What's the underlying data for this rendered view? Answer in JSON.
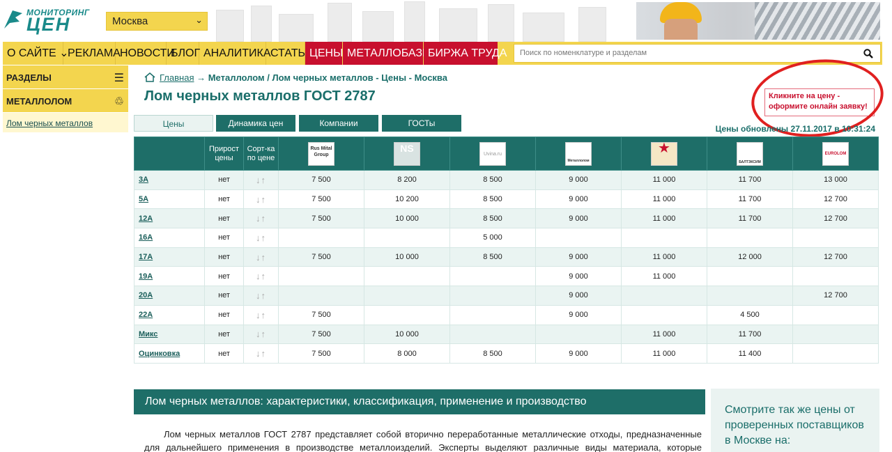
{
  "header": {
    "logo_top": "МОНИТОРИНГ",
    "logo_bottom": "ЦЕН",
    "city": "Москва"
  },
  "nav": {
    "items": [
      {
        "label": "О САЙТЕ",
        "red": false
      },
      {
        "label": "РЕКЛАМА",
        "red": false
      },
      {
        "label": "НОВОСТИ",
        "red": false
      },
      {
        "label": "БЛОГ",
        "red": false
      },
      {
        "label": "АНАЛИТИКА",
        "red": false
      },
      {
        "label": "СТАТЬИ",
        "red": false
      },
      {
        "label": "ЦЕНЫ",
        "red": true
      },
      {
        "label": "МЕТАЛЛОБАЗЫ",
        "red": true
      },
      {
        "label": "БИРЖА ТРУДА",
        "red": true
      }
    ],
    "search_placeholder": "Поиск по номенклатуре и разделам"
  },
  "sidebar": {
    "sections_label": "РАЗДЕЛЫ",
    "category_label": "МЕТАЛЛОЛОМ",
    "link": "Лом черных металлов"
  },
  "breadcrumb": {
    "home": "Главная",
    "rest": "Металлолом / Лом черных металлов - Цены - Москва"
  },
  "page_title": "Лом черных металлов ГОСТ 2787",
  "tabs": [
    "Цены",
    "Динамика цен",
    "Компании",
    "ГОСТы"
  ],
  "hint": "Кликните на цену - оформите онлайн заявку!",
  "updated": "Цены обновлены 27.11.2017 в 10:31:24",
  "table": {
    "headers": {
      "increase": "Прирост цены",
      "sort": "Сорт-ка по цене"
    },
    "companies": [
      "Rus Mital Group",
      "NS",
      "Uvina.ru",
      "Металлолом",
      "",
      "БАЛТЭКСИМ",
      "EUROLOM"
    ],
    "rows": [
      {
        "name": "3А",
        "inc": "нет",
        "v": [
          "7 500",
          "8 200",
          "8 500",
          "9 000",
          "11 000",
          "11 700",
          "13 000"
        ]
      },
      {
        "name": "5А",
        "inc": "нет",
        "v": [
          "7 500",
          "10 200",
          "8 500",
          "9 000",
          "11 000",
          "11 700",
          "12 700"
        ]
      },
      {
        "name": "12А",
        "inc": "нет",
        "v": [
          "7 500",
          "10 000",
          "8 500",
          "9 000",
          "11 000",
          "11 700",
          "12 700"
        ]
      },
      {
        "name": "16А",
        "inc": "нет",
        "v": [
          "",
          "",
          "5 000",
          "",
          "",
          "",
          ""
        ]
      },
      {
        "name": "17А",
        "inc": "нет",
        "v": [
          "7 500",
          "10 000",
          "8 500",
          "9 000",
          "11 000",
          "12 000",
          "12 700"
        ]
      },
      {
        "name": "19А",
        "inc": "нет",
        "v": [
          "",
          "",
          "",
          "9 000",
          "11 000",
          "",
          ""
        ]
      },
      {
        "name": "20А",
        "inc": "нет",
        "v": [
          "",
          "",
          "",
          "9 000",
          "",
          "",
          "12 700"
        ]
      },
      {
        "name": "22А",
        "inc": "нет",
        "v": [
          "7 500",
          "",
          "",
          "9 000",
          "",
          "4 500",
          ""
        ]
      },
      {
        "name": "Микс",
        "inc": "нет",
        "v": [
          "7 500",
          "10 000",
          "",
          "",
          "11 000",
          "11 700",
          ""
        ]
      },
      {
        "name": "Оцинковка",
        "inc": "нет",
        "v": [
          "7 500",
          "8 000",
          "8 500",
          "9 000",
          "11 000",
          "11 400",
          ""
        ]
      }
    ],
    "sort_arrows": "↓↑"
  },
  "section": {
    "heading": "Лом черных металлов: характеристики, классификация, применение и производство",
    "text": "Лом черных металлов ГОСТ 2787 представляет собой вторично переработанные металлические отходы, предназначенные для дальнейшего применения в производстве металлоизделий. Эксперты выделяют различные виды материала, которые необходимо"
  },
  "aside": "Смотрите так же цены от проверенных поставщиков в Москве на:",
  "colors": {
    "teal": "#1e6e68",
    "yellow": "#f3d54e",
    "red": "#c8102e"
  }
}
